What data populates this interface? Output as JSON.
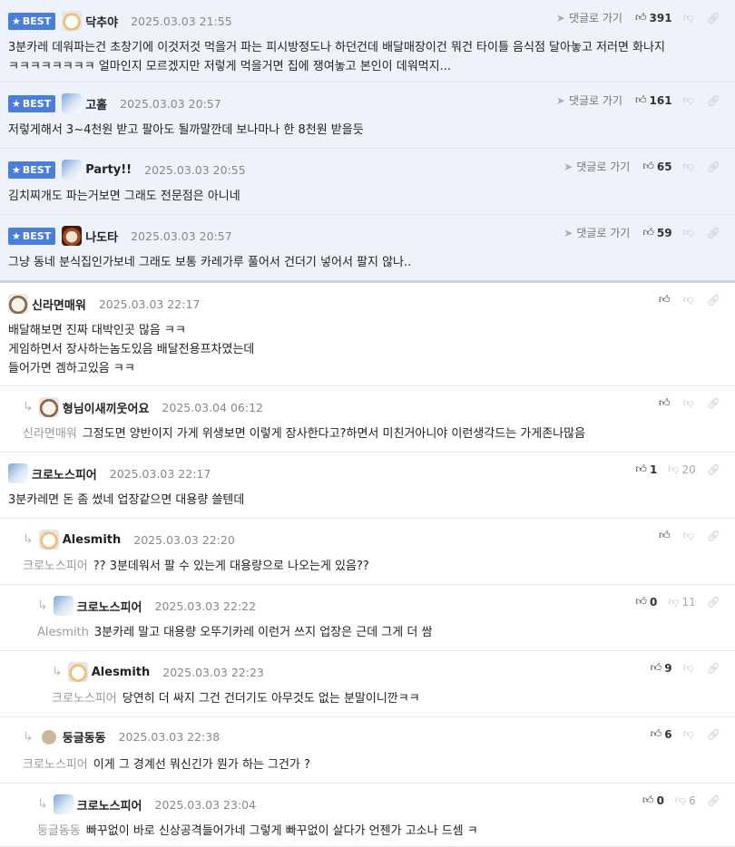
{
  "labels": {
    "best": "BEST",
    "goto": "댓글로 가기"
  },
  "comments": [
    {
      "best": true,
      "avatar": "dog",
      "nick": "닥추야",
      "date": "2025.03.03 21:55",
      "up": "391",
      "lines": [
        "3분카레 데워파는건 초창기에 이것저것 먹을거 파는 피시방정도나 하던건데 배달매장이건 뭐건 타이틀 음식점 달아놓고 저러면 화나지",
        "ㅋㅋㅋㅋㅋㅋㅋㅋ 얼마인지 모르겠지만 저렇게 먹을거면 집에 쟁여놓고 본인이 데워먹지..."
      ]
    },
    {
      "best": true,
      "avatar": "ice",
      "nick": "고홀",
      "date": "2025.03.03 20:57",
      "up": "161",
      "lines": [
        "저렇게해서 3~4천원 받고 팔아도 될까말깐데 보나마나 한 8천원 받을듯"
      ]
    },
    {
      "best": true,
      "avatar": "ice",
      "nick": "Party!!",
      "date": "2025.03.03 20:55",
      "up": "65",
      "lines": [
        "김치찌개도 파는거보면 그래도 전문점은 아니네"
      ]
    },
    {
      "best": true,
      "avatar": "dark",
      "nick": "나도타",
      "date": "2025.03.03 20:57",
      "up": "59",
      "lines": [
        "그냥 동네 분식집인가보네 그래도 보통 카레가루 풀어서 건더기 넣어서 팔지 않나.."
      ]
    },
    {
      "avatar": "bear",
      "nick": "신라면매워",
      "date": "2025.03.03 22:17",
      "lines": [
        "배달해보면 진짜 대박인곳 많음 ㅋㅋ",
        "게임하면서 장사하는놈도있음 배달전용프차였는데",
        "들어가면 겜하고있음 ㅋㅋ"
      ]
    },
    {
      "avatar": "bear",
      "nick": "형님이새끼웃어요",
      "date": "2025.03.04 06:12",
      "to": "신라면매워",
      "lines": [
        "그정도면 양반이지 가게 위생보면 이렇게 장사한다고?하면서 미친거아니야 이런생각드는 가게존나많음"
      ]
    },
    {
      "avatar": "ice",
      "nick": "크로노스피어",
      "date": "2025.03.03 22:17",
      "up": "1",
      "down": "20",
      "lines": [
        "3분카레면 돈 좀 썼네 업장같으면 대용량 쓸텐데"
      ]
    },
    {
      "avatar": "dog",
      "nick": "Alesmith",
      "date": "2025.03.03 22:20",
      "to": "크로노스피어",
      "lines": [
        "?? 3분데워서 팔 수 있는게 대용량으로 나오는게 있음??"
      ]
    },
    {
      "avatar": "ice",
      "nick": "크로노스피어",
      "date": "2025.03.03 22:22",
      "up": "0",
      "down": "11",
      "to": "Alesmith",
      "lines": [
        "3분카레 말고 대용량 오뚜기카레 이런거 쓰지 업장은 근데 그게 더 쌈"
      ]
    },
    {
      "avatar": "dog",
      "nick": "Alesmith",
      "date": "2025.03.03 22:23",
      "up": "9",
      "to": "크로노스피어",
      "lines": [
        "당연히 더 싸지 그건 건더기도 아무것도 없는 분말이니깐ㅋㅋ"
      ]
    },
    {
      "avatar": "dot",
      "nick": "둥글동동",
      "date": "2025.03.03 22:38",
      "up": "6",
      "to": "크로노스피어",
      "lines": [
        "이게 그 경계선 뭐신긴가 뭔가 하는 그건가 ?"
      ]
    },
    {
      "avatar": "ice",
      "nick": "크로노스피어",
      "date": "2025.03.03 23:04",
      "up": "0",
      "down": "6",
      "to": "둥글동동",
      "lines": [
        "빠꾸없이 바로 신상공격들어가네 그렇게 빠꾸없이 살다가 언젠가 고소나 드셈 ㅋ"
      ]
    }
  ]
}
